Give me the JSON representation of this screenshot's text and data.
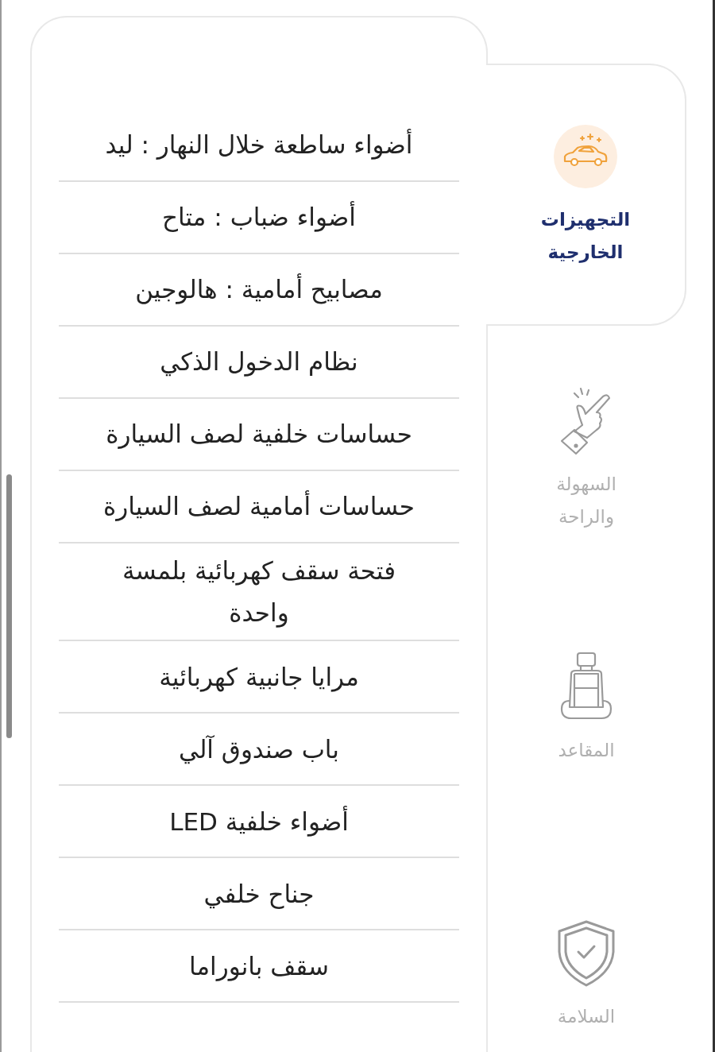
{
  "features": [
    {
      "text": "أضواء ساطعة خلال النهار : ليد"
    },
    {
      "text": "أضواء ضباب : متاح"
    },
    {
      "text": "مصابيح أمامية : هالوجين"
    },
    {
      "text": "نظام الدخول الذكي"
    },
    {
      "text": "حساسات خلفية لصف السيارة"
    },
    {
      "text": "حساسات أمامية لصف السيارة"
    },
    {
      "text": "فتحة سقف كهربائية بلمسة واحدة"
    },
    {
      "text": "مرايا جانبية كهربائية"
    },
    {
      "text": "باب صندوق آلي"
    },
    {
      "text": "أضواء خلفية LED"
    },
    {
      "text": "جناح خلفي"
    },
    {
      "text": "سقف بانوراما"
    }
  ],
  "tabs": [
    {
      "label": "التجهيزات الخارجية",
      "kind": "car",
      "selected": true
    },
    {
      "label": "السهولة والراحة",
      "kind": "hand",
      "selected": false
    },
    {
      "label": "المقاعد",
      "kind": "seat",
      "selected": false
    },
    {
      "label": "السلامة",
      "kind": "shield",
      "selected": false
    }
  ]
}
